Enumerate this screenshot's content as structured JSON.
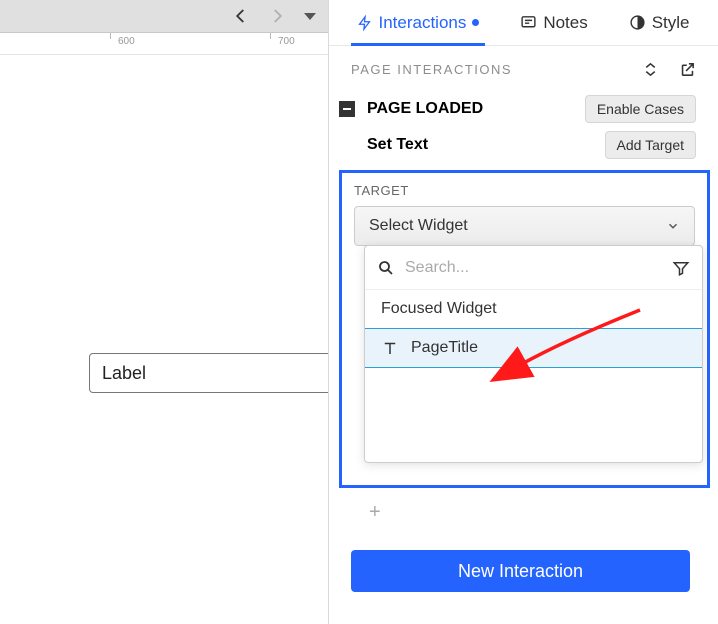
{
  "canvas": {
    "ruler_marks": [
      "600",
      "700"
    ],
    "label_text": "Label"
  },
  "panel": {
    "tabs": {
      "interactions": "Interactions",
      "notes": "Notes",
      "style": "Style"
    },
    "section_title": "PAGE INTERACTIONS",
    "event": {
      "name": "PAGE LOADED",
      "enable_cases": "Enable Cases"
    },
    "action": {
      "name": "Set Text",
      "add_target": "Add Target"
    },
    "target": {
      "label": "TARGET",
      "select_placeholder": "Select Widget",
      "search_placeholder": "Search...",
      "options": [
        {
          "label": "Focused Widget",
          "icon": null
        },
        {
          "label": "PageTitle",
          "icon": "text"
        }
      ]
    },
    "new_interaction": "New Interaction"
  }
}
